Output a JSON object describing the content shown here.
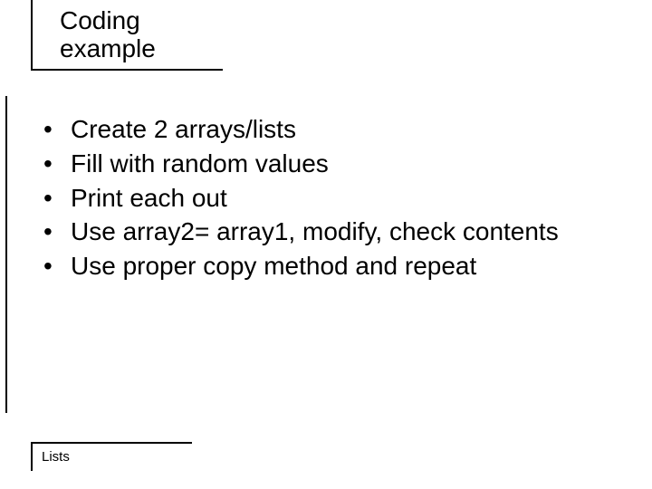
{
  "title": {
    "line1": "Coding",
    "line2": "example"
  },
  "bullets": [
    "Create 2 arrays/lists",
    "Fill with random values",
    "Print each out",
    "Use array2= array1, modify, check contents",
    "Use proper copy method and repeat"
  ],
  "footer": "Lists"
}
